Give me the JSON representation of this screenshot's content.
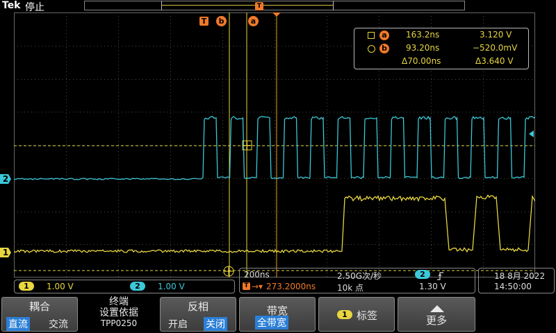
{
  "header": {
    "brand": "Tek",
    "status": "停止"
  },
  "markers": {
    "trigger": "T",
    "cursor_b": "b",
    "cursor_a": "a"
  },
  "cursor_readout": {
    "a": {
      "label": "a",
      "time": "163.2ns",
      "value": "3.120 V"
    },
    "b": {
      "label": "b",
      "time": "93.20ns",
      "value": "−520.0mV"
    },
    "delta": {
      "time": "Δ70.00ns",
      "value": "Δ3.640 V"
    }
  },
  "channels": {
    "ch1": {
      "id": "1",
      "scale": "1.00 V",
      "color": "#e8d640"
    },
    "ch2": {
      "id": "2",
      "scale": "1.00 V",
      "color": "#3cc8d8"
    }
  },
  "horizontal": {
    "time_per_div": "200ns",
    "sample_rate": "2.50G次/秒",
    "trigger_position": "273.2000ns",
    "record_length": "10k 点",
    "trigger_source": "2",
    "trigger_slope_icon": "rising-edge-icon",
    "trigger_level": "1.30 V",
    "trigger_marker": "T"
  },
  "datetime": {
    "date": "18 8月 2022",
    "time": "14:50:00"
  },
  "menu": {
    "coupling": {
      "title": "耦合",
      "options": [
        "直流",
        "交流"
      ],
      "selected": "直流"
    },
    "termination": {
      "title_line1": "终端",
      "title_line2": "设置依据",
      "value": "TPP0250"
    },
    "invert": {
      "title": "反相",
      "options": [
        "开启",
        "关闭"
      ],
      "selected": "关闭"
    },
    "bandwidth": {
      "title": "带宽",
      "value": "全带宽"
    },
    "label": {
      "channel": "1",
      "title": "标签"
    },
    "more": {
      "title": "更多"
    }
  }
}
